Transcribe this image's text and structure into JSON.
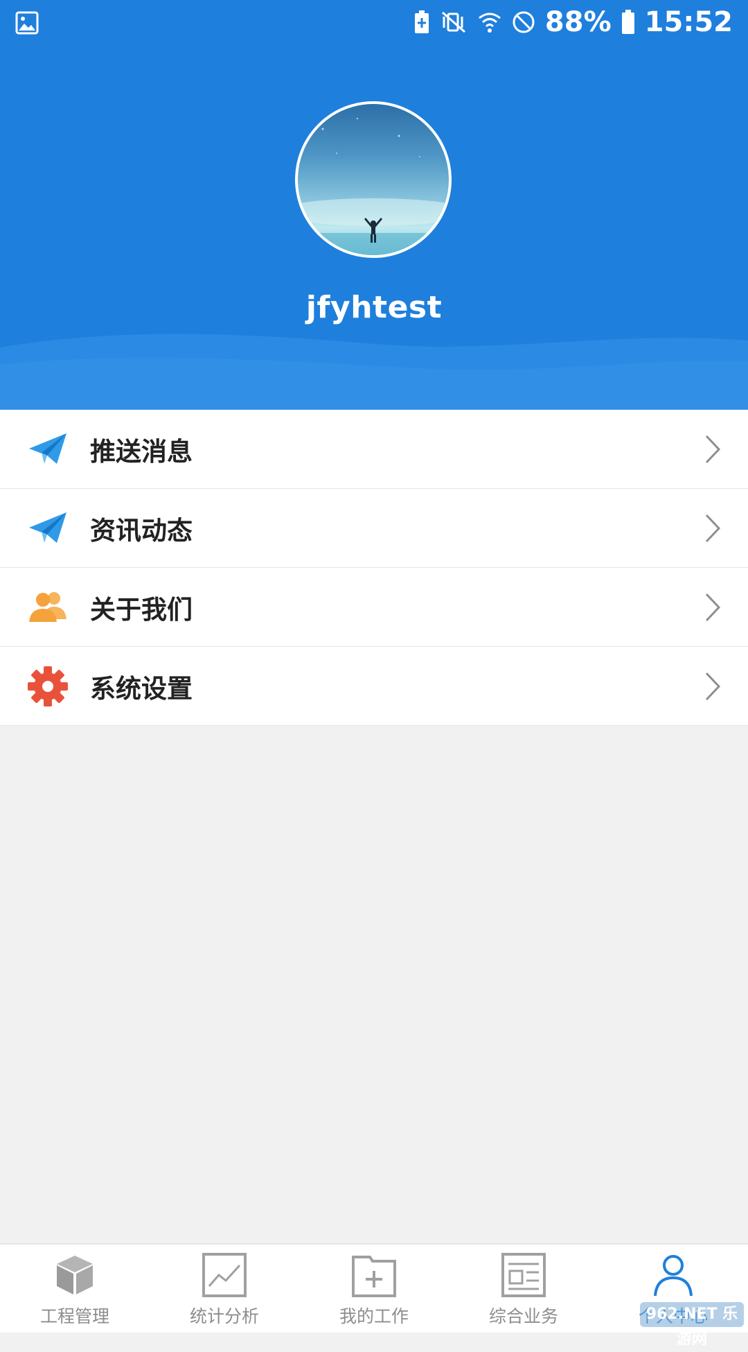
{
  "status_bar": {
    "battery_percent": "88%",
    "time": "15:52",
    "icons": [
      "gallery-icon",
      "battery-saver-icon",
      "mute-vibrate-icon",
      "wifi-icon",
      "do-not-disturb-icon",
      "battery-icon"
    ]
  },
  "profile": {
    "username": "jfyhtest"
  },
  "menu": {
    "items": [
      {
        "label": "推送消息",
        "icon": "paper-plane-icon",
        "color": "#2f9ae8"
      },
      {
        "label": "资讯动态",
        "icon": "paper-plane-icon",
        "color": "#2f9ae8"
      },
      {
        "label": "关于我们",
        "icon": "people-icon",
        "color": "#f5a23d"
      },
      {
        "label": "系统设置",
        "icon": "gear-icon",
        "color": "#e9523a"
      }
    ]
  },
  "bottom_nav": {
    "items": [
      {
        "label": "工程管理",
        "icon": "cube-icon"
      },
      {
        "label": "统计分析",
        "icon": "chart-icon"
      },
      {
        "label": "我的工作",
        "icon": "folder-add-icon"
      },
      {
        "label": "综合业务",
        "icon": "dashboard-icon"
      },
      {
        "label": "个人中心",
        "icon": "user-icon",
        "active": true
      }
    ]
  },
  "watermark": "962.NET 乐游网",
  "colors": {
    "primary": "#1f7fdc",
    "background": "#f1f1f1",
    "nav_inactive": "#8d8d8d"
  }
}
